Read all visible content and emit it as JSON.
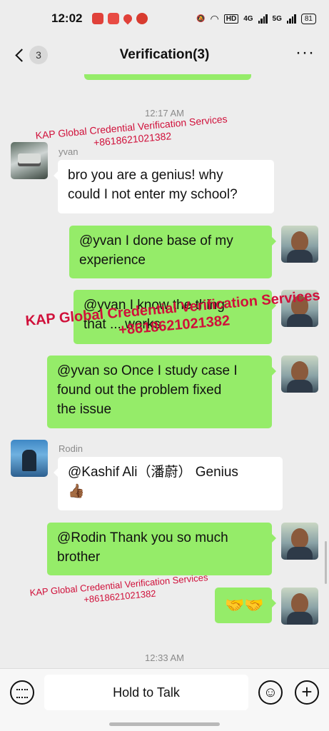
{
  "status_bar": {
    "time": "12:02",
    "hd_label": "HD",
    "net_label_1": "4G",
    "net_label_2": "5G",
    "battery": "81"
  },
  "header": {
    "unread_count": "3",
    "title": "Verification(3)",
    "more_icon": "more-horizontal-icon"
  },
  "timestamps": [
    "12:17 AM",
    "12:33 AM"
  ],
  "messages": [
    {
      "sender": "yvan",
      "direction": "in",
      "lines": [
        "bro you are a genius! why",
        "could I not enter my school?"
      ]
    },
    {
      "sender": "",
      "direction": "out",
      "lines": [
        "@yvan  I done base of my",
        "experience"
      ]
    },
    {
      "sender": "",
      "direction": "out",
      "lines": [
        "@yvan I know the thing",
        "that ... works"
      ]
    },
    {
      "sender": "",
      "direction": "out",
      "lines": [
        "@yvan so Once I study case I",
        "found out the problem fixed",
        "the issue"
      ]
    },
    {
      "sender": "Rodin",
      "direction": "in",
      "lines": [
        "@Kashif Ali（潘蔚） Genius",
        "👍🏾"
      ]
    },
    {
      "sender": "",
      "direction": "out",
      "lines": [
        "@Rodin  Thank you so much",
        "brother"
      ]
    },
    {
      "sender": "",
      "direction": "out",
      "lines": [
        "🤝🤝"
      ]
    }
  ],
  "watermark": {
    "line1": "KAP Global Credential Verification Services",
    "line2": "+8618621021382"
  },
  "input_bar": {
    "hold_label": "Hold to Talk",
    "emoji_icon": "emoji-smile-icon",
    "plus_icon": "plus-circle-icon",
    "keyboard_icon": "keyboard-icon"
  },
  "colors": {
    "outgoing_bubble": "#95ec69",
    "incoming_bubble": "#ffffff",
    "background": "#ededed",
    "watermark": "#d0103a"
  }
}
